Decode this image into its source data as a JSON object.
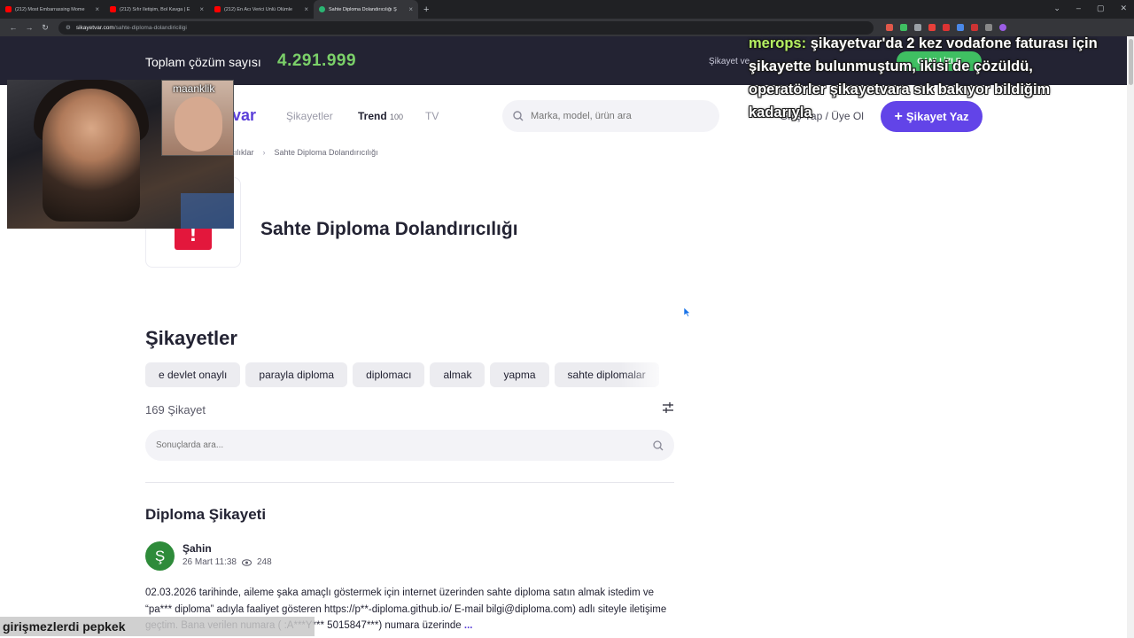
{
  "browser": {
    "tabs": [
      {
        "title": "(212) Most Embarrassing Mome",
        "favicon": "youtube-icon"
      },
      {
        "title": "(212) Sıfır İletişim, Bol Kavga | E",
        "favicon": "youtube-icon"
      },
      {
        "title": "(212) En Acı Verici Ünlü Ölümle",
        "favicon": "youtube-icon"
      },
      {
        "title": "Sahte Diploma Dolandırıcılığı Ş",
        "favicon": "sikayetvar-icon"
      }
    ],
    "url_host": "sikayetvar.com",
    "url_path": "/sahte-diploma-dolandiriciligi"
  },
  "site": {
    "solution_count_label": "Toplam çözüm sayısı",
    "solution_count_value": "4.291.999",
    "top_right_text": "Şikayet ve",
    "top_right_pill": "ÇANLI İZLE",
    "logo_text": "var",
    "nav": {
      "complaints": "Şikayetler",
      "trend": "Trend",
      "trend_count": "100",
      "tv": "TV"
    },
    "search_placeholder": "Marka, model, ürün ara",
    "login_text": "Giriş Yap / Üye Ol",
    "write_button": "Şikayet Yaz",
    "accent_color": "#6244e8",
    "count_color": "#7bd069"
  },
  "breadcrumb": {
    "parent": "ıcılıklar",
    "current": "Sahte Diploma Dolandırıcılığı"
  },
  "brand": {
    "title": "Sahte Diploma Dolandırıcılığı",
    "icon": "exclamation-icon",
    "icon_glyph": "!"
  },
  "complaints": {
    "section_title": "Şikayetler",
    "chips": [
      "e devlet onaylı",
      "parayla diploma",
      "diplomacı",
      "almak",
      "yapma",
      "sahte diplomalar"
    ],
    "count_text": "169 Şikayet",
    "search_placeholder": "Sonuçlarda ara...",
    "items": [
      {
        "title": "Diploma Şikayeti",
        "author": "Şahin",
        "avatar_letter": "Ş",
        "date": "26 Mart 11:38",
        "views": "248",
        "body": "02.03.2026 tarihinde, aileme şaka amaçlı göstermek için internet üzerinden sahte diploma satın almak istedim ve “pa*** diploma” adıyla faaliyet gösteren https://p**-diploma.github.io/ E-mail bilgi@diploma.com) adlı siteyle iletişime geçtim. Bana verilen numara ( :A***Y*** 5015847***) numara üzerinde",
        "more": "..."
      }
    ]
  },
  "overlays": {
    "webcam_label": "maanklik",
    "chat_user": "merops:",
    "chat_message": "şikayetvar'da 2 kez vodafone faturası için şikayette bulunmuştum, ikisi de çözüldü, operatörler şikayetvara sık bakıyor bildiğim kadarıyla",
    "bottom_caption": "girişmezlerdi pepkek"
  }
}
